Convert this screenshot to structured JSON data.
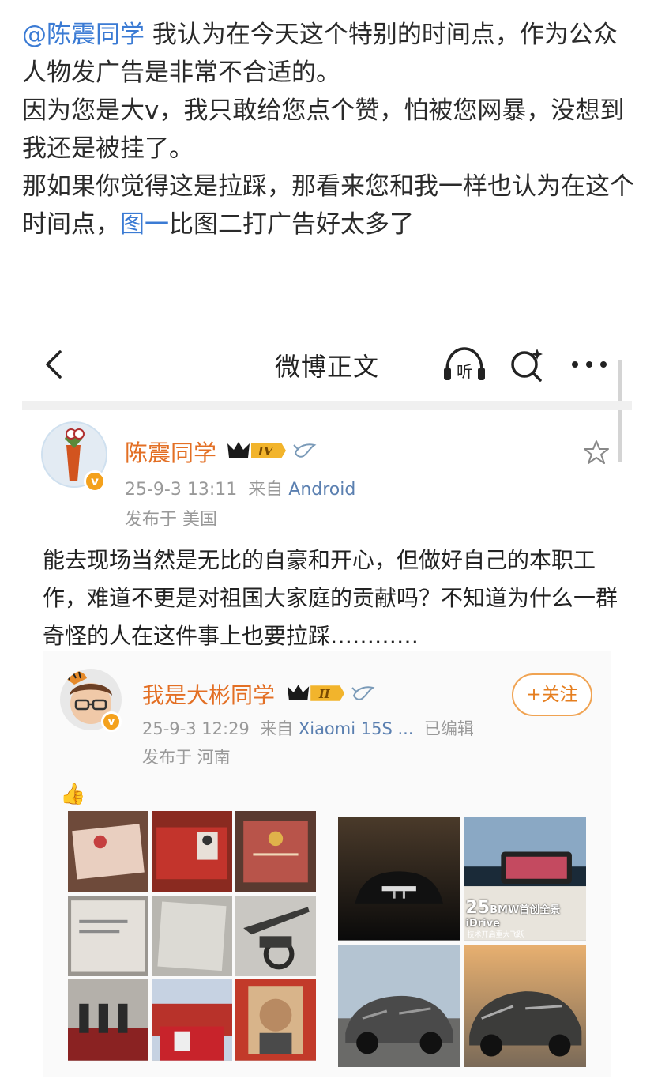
{
  "comment": {
    "mention": "@陈震同学",
    "line1_rest": " 我认为在今天这个特别的时间点，作为公众人物发广告是非常不合适的。",
    "line2": "因为您是大v，我只敢给您点个赞，怕被您网暴，没想到我还是被挂了。",
    "line3_prefix": "那如果你觉得这是拉踩，那看来您和我一样也认为在这个时间点，",
    "line3_link": "图一",
    "line3_suffix": "比图二打广告好太多了"
  },
  "navbar": {
    "title": "微博正文",
    "listen_label": "听"
  },
  "post": {
    "author": "陈震同学",
    "level": "IV",
    "verified_badge": "v",
    "date": "25-9-3 13:11",
    "from_label": "来自",
    "source": "Android",
    "location": "发布于 美国",
    "content": "能去现场当然是无比的自豪和开心，但做好自己的本职工作，难道不更是对祖国大家庭的贡献吗？不知道为什么一群奇怪的人在这件事上也要拉踩…………"
  },
  "repost": {
    "author": "我是大彬同学",
    "level": "II",
    "verified_badge": "v",
    "date": "25-9-3 12:29",
    "from_label": "来自",
    "source": "Xiaomi 15S ...",
    "edited": "已编辑",
    "location": "发布于 河南",
    "follow_label": "+关注",
    "thumb_emoji": "👍",
    "bmw_caption_big": "25",
    "bmw_caption": "BMW首创全景iDrive",
    "bmw_sub": "技术开启重大飞跃"
  },
  "colors": {
    "link": "#3b7bd4",
    "username": "#e36f24",
    "meta": "#999999",
    "follow": "#e57e1f",
    "badge_gold": "#f4a11c"
  }
}
